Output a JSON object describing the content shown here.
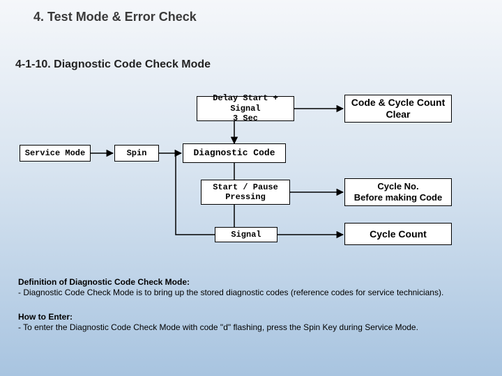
{
  "title": "4. Test Mode & Error Check",
  "subtitle": "4-1-10.  Diagnostic Code Check Mode",
  "boxes": {
    "delay": "Delay Start + Signal\n3 Sec",
    "clear": "Code & Cycle Count\nClear",
    "service": "Service Mode",
    "spin": "Spin",
    "diag": "Diagnostic Code",
    "start": "Start / Pause\nPressing",
    "cycleno": "Cycle No.\nBefore making Code",
    "signal": "Signal",
    "cyclecount": "Cycle Count"
  },
  "definition": {
    "heading": "Definition of Diagnostic Code Check Mode:",
    "body": "- Diagnostic Code Check Mode is to bring up the stored diagnostic codes (reference codes for service technicians)."
  },
  "howto": {
    "heading": "How to Enter:",
    "body": "- To enter the Diagnostic Code Check Mode with code \"d\" flashing, press the Spin Key during Service Mode."
  }
}
